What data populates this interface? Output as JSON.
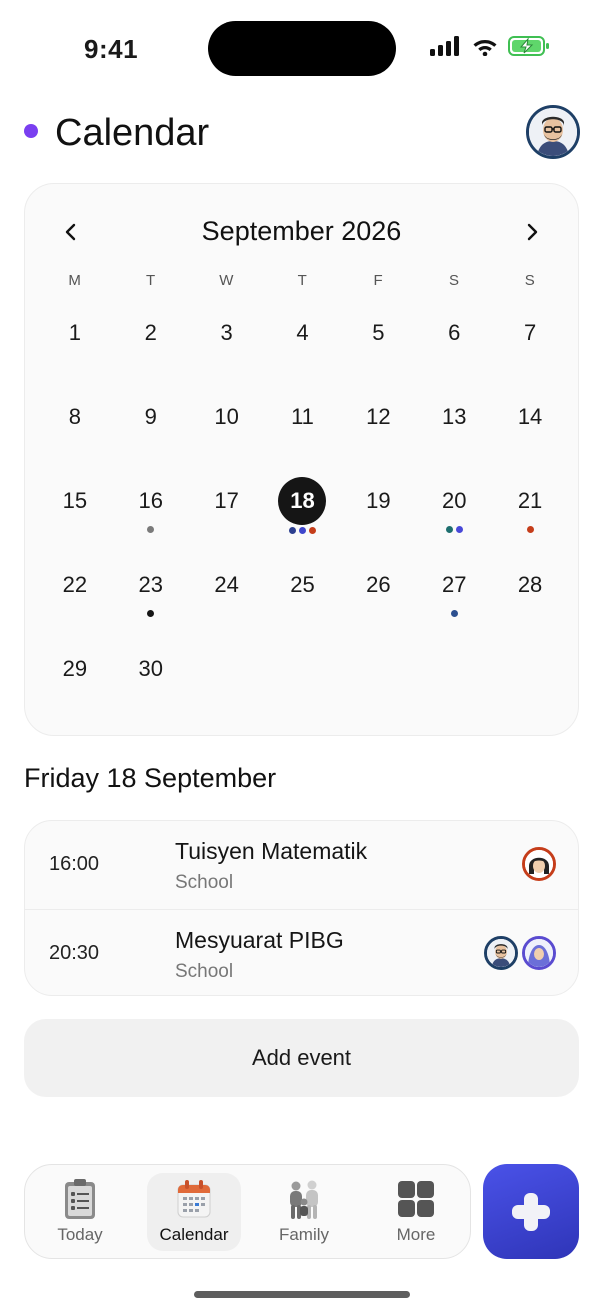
{
  "status_bar": {
    "time": "9:41"
  },
  "header": {
    "title": "Calendar",
    "accent": "#7a3ff0"
  },
  "calendar": {
    "month_label": "September 2026",
    "weekdays": [
      "M",
      "T",
      "W",
      "T",
      "F",
      "S",
      "S"
    ],
    "first_weekday_offset": 1,
    "selected_day": 18,
    "days": [
      {
        "n": "1",
        "dots": []
      },
      {
        "n": "2",
        "dots": []
      },
      {
        "n": "3",
        "dots": []
      },
      {
        "n": "4",
        "dots": []
      },
      {
        "n": "5",
        "dots": []
      },
      {
        "n": "6",
        "dots": []
      },
      {
        "n": "7",
        "dots": []
      },
      {
        "n": "8",
        "dots": []
      },
      {
        "n": "9",
        "dots": []
      },
      {
        "n": "10",
        "dots": []
      },
      {
        "n": "11",
        "dots": []
      },
      {
        "n": "12",
        "dots": []
      },
      {
        "n": "13",
        "dots": []
      },
      {
        "n": "14",
        "dots": []
      },
      {
        "n": "15",
        "dots": []
      },
      {
        "n": "16",
        "dots": [
          "#7a7a7a"
        ]
      },
      {
        "n": "17",
        "dots": []
      },
      {
        "n": "18",
        "dots": [
          "#2c3f8f",
          "#3e46cc",
          "#c53d1a"
        ]
      },
      {
        "n": "19",
        "dots": []
      },
      {
        "n": "20",
        "dots": [
          "#1d6e6e",
          "#4848d8"
        ]
      },
      {
        "n": "21",
        "dots": [
          "#c53d1a"
        ]
      },
      {
        "n": "22",
        "dots": []
      },
      {
        "n": "23",
        "dots": [
          "#151515"
        ]
      },
      {
        "n": "24",
        "dots": []
      },
      {
        "n": "25",
        "dots": []
      },
      {
        "n": "26",
        "dots": []
      },
      {
        "n": "27",
        "dots": [
          "#2c4f8f"
        ]
      },
      {
        "n": "28",
        "dots": []
      },
      {
        "n": "29",
        "dots": []
      },
      {
        "n": "30",
        "dots": []
      }
    ]
  },
  "selected_date_heading": "Friday 18 September",
  "events": [
    {
      "time": "16:00",
      "title": "Tuisyen Matematik",
      "category": "School",
      "avatars": [
        {
          "icon": "girl-avatar-icon",
          "ring": "#c53d1a"
        }
      ]
    },
    {
      "time": "20:30",
      "title": "Mesyuarat PIBG",
      "category": "School",
      "avatars": [
        {
          "icon": "man-avatar-icon",
          "ring": "#1e3f66"
        },
        {
          "icon": "woman-hijab-avatar-icon",
          "ring": "#5a4bd0"
        }
      ]
    }
  ],
  "add_event_label": "Add event",
  "tabs": [
    {
      "label": "Today",
      "icon": "clipboard-icon",
      "active": false
    },
    {
      "label": "Calendar",
      "icon": "calendar-icon",
      "active": true
    },
    {
      "label": "Family",
      "icon": "family-icon",
      "active": false
    },
    {
      "label": "More",
      "icon": "grid-icon",
      "active": false
    }
  ],
  "fab": {
    "icon": "plus-icon",
    "color": "#3a40d0"
  }
}
